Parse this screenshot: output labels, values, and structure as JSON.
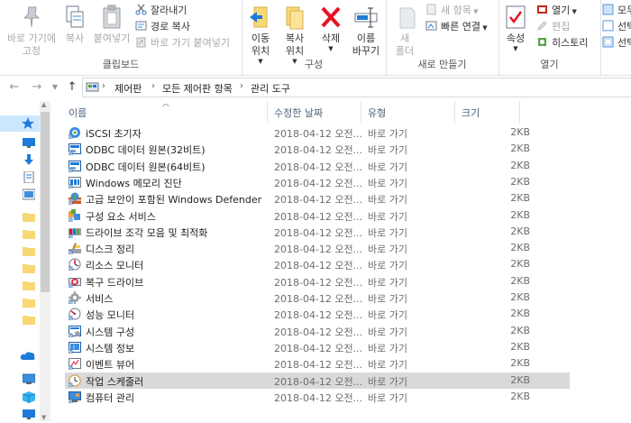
{
  "ribbon": {
    "clipboard": {
      "label": "클립보드",
      "pin_label_1": "바로 가기에",
      "pin_label_2": "고정",
      "copy": "복사",
      "paste": "붙여넣기",
      "cut": "잘라내기",
      "copy_path": "경로 복사",
      "paste_shortcut": "바로 가기 붙여넣기"
    },
    "organize": {
      "label": "구성",
      "move_to_1": "이동",
      "move_to_2": "위치",
      "copy_to_1": "복사",
      "copy_to_2": "위치",
      "delete": "삭제",
      "rename_1": "이름",
      "rename_2": "바꾸기"
    },
    "new": {
      "label": "새로 만들기",
      "new_folder_1": "새",
      "new_folder_2": "폴더",
      "new_item": "새 항목",
      "easy_access": "빠른 연결"
    },
    "open": {
      "label": "열기",
      "properties": "속성",
      "open": "열기",
      "edit": "편집",
      "history": "히스토리"
    },
    "select": {
      "select_all": "모두",
      "select_none": "선택",
      "invert": "선택"
    }
  },
  "address": {
    "breadcrumbs": [
      "제어판",
      "모든 제어판 항목",
      "관리 도구"
    ]
  },
  "columns": {
    "name": "이름",
    "modified": "수정한 날짜",
    "type": "유형",
    "size": "크기"
  },
  "files": [
    {
      "name": "iSCSI 초기자",
      "date": "2018-04-12 오전...",
      "type": "바로 가기",
      "size": "2KB",
      "icon": "iscsi-icon"
    },
    {
      "name": "ODBC 데이터 원본(32비트)",
      "date": "2018-04-12 오전...",
      "type": "바로 가기",
      "size": "2KB",
      "icon": "odbc-icon"
    },
    {
      "name": "ODBC 데이터 원본(64비트)",
      "date": "2018-04-12 오전...",
      "type": "바로 가기",
      "size": "2KB",
      "icon": "odbc-icon"
    },
    {
      "name": "Windows 메모리 진단",
      "date": "2018-04-12 오전...",
      "type": "바로 가기",
      "size": "2KB",
      "icon": "memory-diagnostic-icon"
    },
    {
      "name": "고급 보안이 포함된 Windows Defender",
      "date": "2018-04-12 오전...",
      "type": "바로 가기",
      "size": "2KB",
      "icon": "firewall-icon"
    },
    {
      "name": "구성 요소 서비스",
      "date": "2018-04-12 오전...",
      "type": "바로 가기",
      "size": "2KB",
      "icon": "component-services-icon"
    },
    {
      "name": "드라이브 조각 모음 및 최적화",
      "date": "2018-04-12 오전...",
      "type": "바로 가기",
      "size": "2KB",
      "icon": "defrag-icon"
    },
    {
      "name": "디스크 정리",
      "date": "2018-04-12 오전...",
      "type": "바로 가기",
      "size": "2KB",
      "icon": "disk-cleanup-icon"
    },
    {
      "name": "리소스 모니터",
      "date": "2018-04-12 오전...",
      "type": "바로 가기",
      "size": "2KB",
      "icon": "resource-monitor-icon"
    },
    {
      "name": "복구 드라이브",
      "date": "2018-04-12 오전...",
      "type": "바로 가기",
      "size": "2KB",
      "icon": "recovery-drive-icon"
    },
    {
      "name": "서비스",
      "date": "2018-04-12 오전...",
      "type": "바로 가기",
      "size": "2KB",
      "icon": "services-icon"
    },
    {
      "name": "성능 모니터",
      "date": "2018-04-12 오전...",
      "type": "바로 가기",
      "size": "2KB",
      "icon": "performance-monitor-icon"
    },
    {
      "name": "시스템 구성",
      "date": "2018-04-12 오전...",
      "type": "바로 가기",
      "size": "2KB",
      "icon": "system-config-icon"
    },
    {
      "name": "시스템 정보",
      "date": "2018-04-12 오전...",
      "type": "바로 가기",
      "size": "2KB",
      "icon": "system-info-icon"
    },
    {
      "name": "이벤트 뷰어",
      "date": "2018-04-12 오전...",
      "type": "바로 가기",
      "size": "2KB",
      "icon": "event-viewer-icon"
    },
    {
      "name": "작업 스케줄러",
      "date": "2018-04-12 오전...",
      "type": "바로 가기",
      "size": "2KB",
      "icon": "task-scheduler-icon",
      "selected": true
    },
    {
      "name": "컴퓨터 관리",
      "date": "2018-04-12 오전...",
      "type": "바로 가기",
      "size": "2KB",
      "icon": "computer-management-icon"
    }
  ],
  "colors": {
    "selected_row": "#d9d9d9",
    "header_text": "#4c607a",
    "folder_yellow": "#f8d775",
    "accent_blue": "#1e7ad8",
    "delete_red": "#e81123"
  }
}
